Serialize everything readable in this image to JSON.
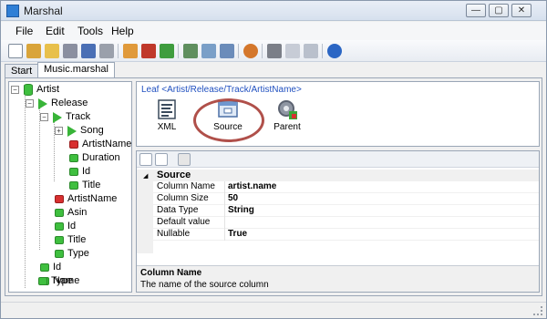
{
  "window": {
    "title": "Marshal",
    "minimize": "—",
    "maximize": "▢",
    "close": "✕"
  },
  "menu": [
    "File",
    "Edit",
    "Tools",
    "Help"
  ],
  "toolbar_icons": [
    "new-file-icon",
    "wand-icon",
    "open-folder-icon",
    "save-icon",
    "save-all-icon",
    "print-icon",
    "export-icon",
    "import-icon",
    "database-icon",
    "xml-icon",
    "check-icon",
    "document-icon",
    "settings-icon",
    "cut-icon",
    "copy-icon",
    "paste-icon",
    "help-icon"
  ],
  "tabs": [
    "Start",
    "Music.marshal"
  ],
  "tree": [
    {
      "label": "Artist"
    },
    {
      "label": "Release"
    },
    {
      "label": "Track"
    },
    {
      "label": "Song"
    },
    {
      "label": "ArtistName"
    },
    {
      "label": "Duration"
    },
    {
      "label": "Id"
    },
    {
      "label": "Title"
    },
    {
      "label": "ArtistName"
    },
    {
      "label": "Asin"
    },
    {
      "label": "Id"
    },
    {
      "label": "Title"
    },
    {
      "label": "Type"
    },
    {
      "label": "Id"
    },
    {
      "label": "Name"
    },
    {
      "label": "Type"
    }
  ],
  "leaf": {
    "title": "Leaf <Artist/Release/Track/ArtistName>",
    "buttons": [
      {
        "label": "XML"
      },
      {
        "label": "Source"
      },
      {
        "label": "Parent"
      }
    ]
  },
  "properties": {
    "category": "Source",
    "rows": [
      {
        "key": "Column Name",
        "value": "artist.name"
      },
      {
        "key": "Column Size",
        "value": "50"
      },
      {
        "key": "Data Type",
        "value": "String"
      },
      {
        "key": "Default value",
        "value": ""
      },
      {
        "key": "Nullable",
        "value": "True"
      }
    ],
    "help_title": "Column Name",
    "help_desc": "The name of the source column"
  },
  "colors": {
    "highlight": "#b0504a",
    "leaf_title": "#2050c0",
    "green": "#3fbf3f",
    "red": "#d83030"
  }
}
